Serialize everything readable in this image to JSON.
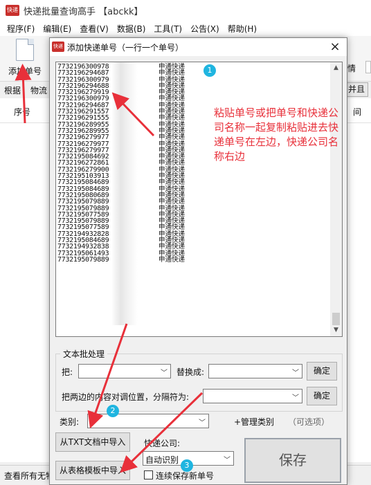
{
  "main": {
    "title": "快递批量查询高手 【abckk】",
    "app_icon_text": "快递",
    "menu": [
      "程序(F)",
      "编辑(E)",
      "查看(V)",
      "数据(B)",
      "工具(T)",
      "公告(X)",
      "帮助(H)"
    ],
    "toolbar": {
      "add_label": "添加单号",
      "right_partial": "情"
    },
    "tabs": {
      "left_a": "根据",
      "left_b": "物流",
      "right": "并且"
    },
    "list_headers": {
      "no": "序号",
      "time": "间"
    },
    "status": "查看所有无物"
  },
  "dialog": {
    "title": "添加快递单号（一行一个单号）",
    "close": "×",
    "lines": [
      {
        "num": "7732196300978",
        "company": "申通快递"
      },
      {
        "num": "7732196294687",
        "company": "申通快递"
      },
      {
        "num": "7732196300979",
        "company": "申通快递"
      },
      {
        "num": "7732196294688",
        "company": "申通快递"
      },
      {
        "num": "7732196279919",
        "company": "申通快递"
      },
      {
        "num": "7732196300979",
        "company": "申通快递"
      },
      {
        "num": "7732196294687",
        "company": "申通快递"
      },
      {
        "num": "7732196291557",
        "company": "申通快递"
      },
      {
        "num": "7732196291555",
        "company": "申通快递"
      },
      {
        "num": "7732196289955",
        "company": "申通快递"
      },
      {
        "num": "7732196289955",
        "company": "申通快递"
      },
      {
        "num": "7732196279977",
        "company": "申通快递"
      },
      {
        "num": "7732196279977",
        "company": "申通快递"
      },
      {
        "num": "7732196279977",
        "company": "申通快递"
      },
      {
        "num": "7732195084692",
        "company": "申通快递"
      },
      {
        "num": "7732196272861",
        "company": "申通快递"
      },
      {
        "num": "7732196279900",
        "company": "申通快递"
      },
      {
        "num": "7732195103913",
        "company": "申通快递"
      },
      {
        "num": "7732195084689",
        "company": "申通快递"
      },
      {
        "num": "7732195084689",
        "company": "申通快递"
      },
      {
        "num": "7732195080689",
        "company": "申通快递"
      },
      {
        "num": "7732195079889",
        "company": "申通快递"
      },
      {
        "num": "7732195079889",
        "company": "申通快递"
      },
      {
        "num": "7732195077589",
        "company": "申通快递"
      },
      {
        "num": "7732195079889",
        "company": "申通快递"
      },
      {
        "num": "7732195077589",
        "company": "申通快递"
      },
      {
        "num": "7732194932828",
        "company": "申通快递"
      },
      {
        "num": "7732195084689",
        "company": "申通快递"
      },
      {
        "num": "7732194932838",
        "company": "申通快递"
      },
      {
        "num": "7732195061493",
        "company": "申通快递"
      },
      {
        "num": "7732195079889",
        "company": "申通快递"
      }
    ],
    "annotation": "粘贴单号或把单号和快递公司名称一起复制粘贴进去快递单号在左边，快递公司名称右边",
    "badges": [
      "1",
      "2",
      "3"
    ],
    "batch_group": {
      "title": "文本批处理",
      "from_label": "把:",
      "to_label": "替换成:",
      "confirm1": "确定",
      "swap_label": "把两边的内容对调位置，分隔符为:",
      "confirm2": "确定"
    },
    "category": {
      "label": "类别:",
      "manage": "+管理类别",
      "optional": "（可选项）"
    },
    "import_txt": "从TXT文档中导入",
    "import_excel": "从表格模板中导入",
    "courier": {
      "label": "快递公司:",
      "value": "自动识别"
    },
    "save": "保存",
    "auto_save": "连续保存新单号",
    "annotation_color": "#e8303a",
    "badge_color": "#1fb5e0"
  }
}
